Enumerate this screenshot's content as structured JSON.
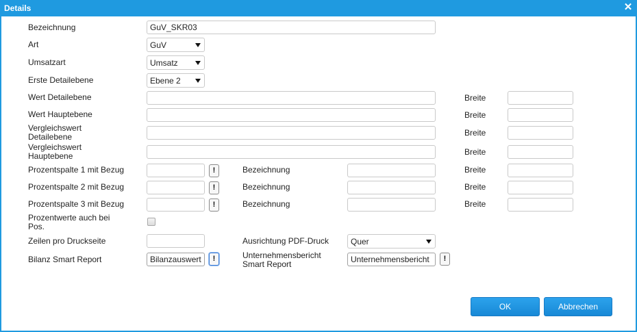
{
  "dialog": {
    "title": "Details"
  },
  "form": {
    "bezeichnung": {
      "label": "Bezeichnung",
      "value": "GuV_SKR03"
    },
    "art": {
      "label": "Art",
      "value": "GuV"
    },
    "umsatzart": {
      "label": "Umsatzart",
      "value": "Umsatz"
    },
    "erste_detailebene": {
      "label": "Erste Detailebene",
      "value": "Ebene 2"
    },
    "wert_detailebene": {
      "label": "Wert Detailebene",
      "value": ""
    },
    "wert_hauptebene": {
      "label": "Wert Hauptebene",
      "value": ""
    },
    "vergleichswert_detailebene": {
      "label_line1": "Vergleichswert",
      "label_line2": "Detailebene",
      "value": ""
    },
    "vergleichswert_hauptebene": {
      "label_line1": "Vergleichswert",
      "label_line2": "Hauptebene",
      "value": ""
    },
    "breite_label": "Breite",
    "bezeichnung_label": "Bezeichnung",
    "prozentspalte_1": {
      "label": "Prozentspalte 1 mit Bezug"
    },
    "prozentspalte_2": {
      "label": "Prozentspalte 2 mit Bezug"
    },
    "prozentspalte_3": {
      "label": "Prozentspalte 3 mit Bezug"
    },
    "prozentwerte": {
      "label_line1": "Prozentwerte auch bei",
      "label_line2": "Pos.",
      "checked": false
    },
    "zeilen_pro_druckseite": {
      "label": "Zeilen pro Druckseite",
      "value": ""
    },
    "ausrichtung_pdf": {
      "label": "Ausrichtung PDF-Druck",
      "value": "Quer"
    },
    "bilanz_smart_report": {
      "label": "Bilanz Smart Report",
      "value": "Bilanzauswert"
    },
    "unternehmensbericht": {
      "label_line1": "Unternehmensbericht",
      "label_line2": "Smart Report",
      "value": "Unternehmensbericht"
    },
    "info_button_glyph": "!"
  },
  "buttons": {
    "ok": "OK",
    "cancel": "Abbrechen"
  },
  "icons": {
    "close": "close-icon",
    "dropdown": "chevron-down-icon"
  },
  "colors": {
    "accent": "#1f9ae0",
    "button": "#1889d6"
  }
}
